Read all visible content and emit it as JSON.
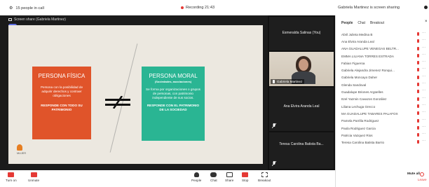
{
  "topbar": {
    "people_count": "15 people in call",
    "recording": "Recording 21:43",
    "share_note": "Gabriela Martinez is screen sharing"
  },
  "stage": {
    "share_label": "Screen share (Gabriela Martinez)",
    "slide": {
      "fisica": {
        "title": "PERSONA FÍSICA",
        "desc": "Persona con la posibilidad de adquirir derechos y contraer obligaciones",
        "footer": "RESPONDE CON TODO SU PATRIMONIO"
      },
      "moral": {
        "title": "PERSONA MORAL",
        "subtitle": "(Sociedades, asociaciones)",
        "desc": "Se forma por organizaciones o grupos de personas, con patrimonio independiente de sus socios.",
        "footer": "RESPONDE CON EL PATRIMONIO DE LA SOCIEDAD"
      },
      "logo_text": "MUJER"
    }
  },
  "tiles": [
    {
      "name": "Esmeralda Salinas (You)"
    },
    {
      "name": "Gabriela Martinez"
    },
    {
      "name": "Ana Elvira Aranda Leal"
    },
    {
      "name": "Teresa Carolina Batista Ba..."
    }
  ],
  "panel": {
    "tabs": [
      "People",
      "Chat",
      "Breakout"
    ],
    "people": [
      "Abril Julieta Medina B",
      "Ana Elvira Aranda Leal",
      "ANA GUADALUPE VENEGAS BELTR...",
      "EMMA LILIANA TORRES ESTRADA",
      "Fabian Figueroa",
      "Gabriela Alejandra Jimenez Ronqui...",
      "Gabriela Moncayo Daher",
      "Glenda Sandoval",
      "Guadalupe Briones Argüelles",
      "Itzel Yazmin Cavazos González",
      "Liliana Lechuga Grecco",
      "MA GUADALUPE TABARES PALAFOX",
      "Pamela Parrilla Rodriguez",
      "Paola Rodriguez Garcia",
      "Patricia Vazquez Rios",
      "Teresa Carolina Batista Barrio"
    ],
    "mute_all": "Mute all"
  },
  "bottombar": {
    "turn_on": "Turn on",
    "unmute": "Unmute",
    "people": "People",
    "chat": "Chat",
    "share": "Share",
    "stop": "Stop",
    "breakout": "Breakout",
    "leave": "Leave"
  },
  "colors": {
    "fisica": "#e0542a",
    "moral": "#2ab593",
    "accent": "#5b6be0",
    "danger": "#e53935"
  }
}
